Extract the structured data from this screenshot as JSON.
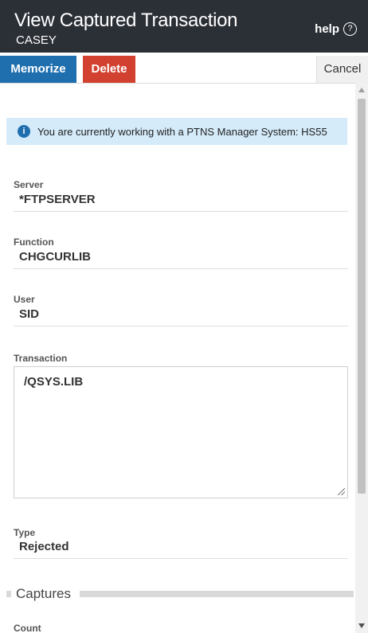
{
  "header": {
    "title": "View Captured Transaction",
    "subtitle": "CASEY",
    "help_label": "help",
    "help_icon": "question-circle-icon"
  },
  "toolbar": {
    "memorize_label": "Memorize",
    "delete_label": "Delete",
    "cancel_label": "Cancel"
  },
  "info": {
    "icon": "info-icon",
    "message": "You are currently working with a PTNS Manager System: HS55"
  },
  "fields": {
    "server": {
      "label": "Server",
      "value": "*FTPSERVER"
    },
    "function": {
      "label": "Function",
      "value": "CHGCURLIB"
    },
    "user": {
      "label": "User",
      "value": "SID"
    },
    "transaction": {
      "label": "Transaction",
      "value": "/QSYS.LIB"
    },
    "type": {
      "label": "Type",
      "value": "Rejected"
    }
  },
  "captures": {
    "heading": "Captures",
    "count_label": "Count"
  },
  "colors": {
    "header_bg": "#2b2f36",
    "memorize_bg": "#1f6fae",
    "delete_bg": "#d24130",
    "info_bg": "#d5ebfa"
  }
}
